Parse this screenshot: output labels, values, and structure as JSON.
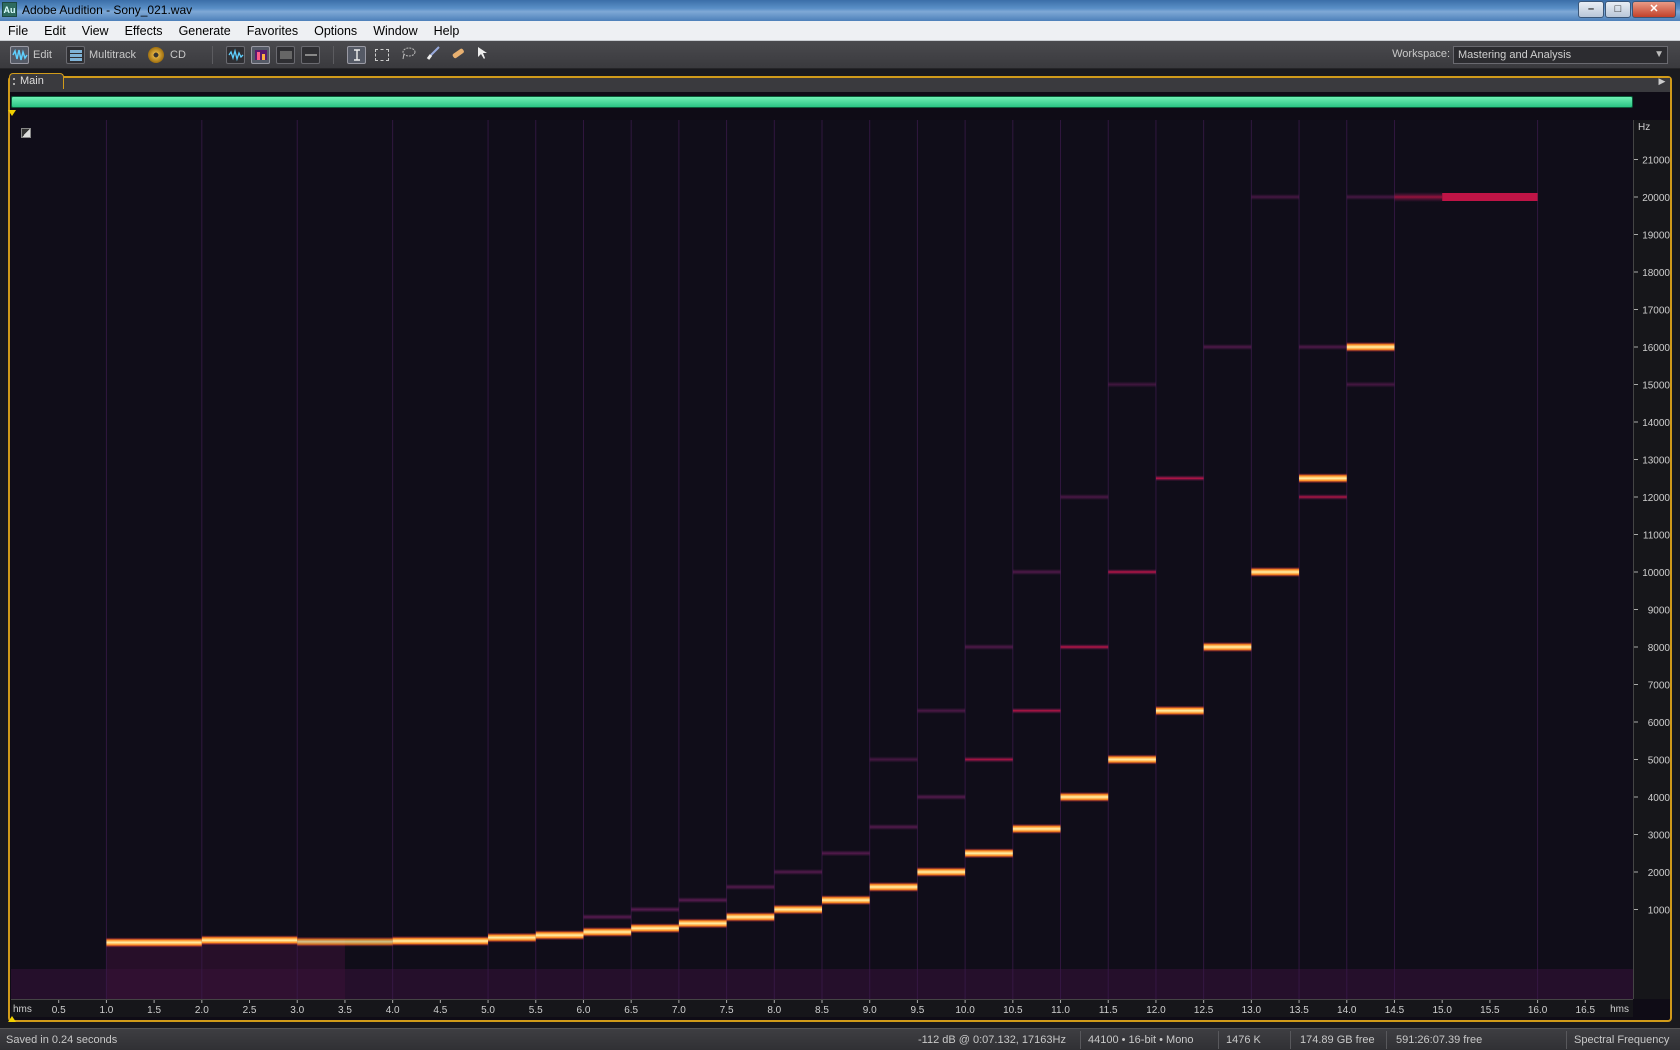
{
  "window": {
    "app_icon": "Au",
    "title": "Adobe Audition - Sony_021.wav",
    "controls": [
      "minimize",
      "maximize",
      "close"
    ]
  },
  "menu": [
    "File",
    "Edit",
    "View",
    "Effects",
    "Generate",
    "Favorites",
    "Options",
    "Window",
    "Help"
  ],
  "toolbar": {
    "views": [
      {
        "label": "Edit",
        "icon": "waveform-edit-icon",
        "active": true
      },
      {
        "label": "Multitrack",
        "icon": "multitrack-icon",
        "active": false
      },
      {
        "label": "CD",
        "icon": "cd-icon",
        "active": false
      }
    ],
    "display_modes": [
      "waveform-display-icon",
      "spectral-display-icon",
      "pan-display-icon",
      "phase-display-icon"
    ],
    "tools": [
      "time-selection-icon",
      "marquee-icon",
      "lasso-icon",
      "brush-icon",
      "spot-healing-icon",
      "move-icon"
    ],
    "workspace_label": "Workspace:",
    "workspace_value": "Mastering and Analysis"
  },
  "panel": {
    "tab_label": "Main"
  },
  "rulers": {
    "freq_unit": "Hz",
    "freq_ticks": [
      "21000",
      "20000",
      "19000",
      "18000",
      "17000",
      "16000",
      "15000",
      "14000",
      "13000",
      "12000",
      "11000",
      "10000",
      "9000",
      "8000",
      "7000",
      "6000",
      "5000",
      "4000",
      "3000",
      "2000",
      "1000"
    ],
    "time_unit": "hms",
    "time_ticks": [
      "0.5",
      "1.0",
      "1.5",
      "2.0",
      "2.5",
      "3.0",
      "3.5",
      "4.0",
      "4.5",
      "5.0",
      "5.5",
      "6.0",
      "6.5",
      "7.0",
      "7.5",
      "8.0",
      "8.5",
      "9.0",
      "9.5",
      "10.0",
      "10.5",
      "11.0",
      "11.5",
      "12.0",
      "12.5",
      "13.0",
      "13.5",
      "14.0",
      "14.5",
      "15.0",
      "15.5",
      "16.0",
      "16.5"
    ]
  },
  "spectrogram": {
    "freq_max_hz": 22050,
    "time_max_s": 17.0,
    "colors": {
      "background": "#100d19",
      "hot": "#fff2a8",
      "warm": "#ff8a1e",
      "mid": "#d3154b",
      "dim": "#6a1e5e"
    },
    "tones": [
      {
        "start": 1.0,
        "end": 2.0,
        "f": 120,
        "level": 1.0
      },
      {
        "start": 2.0,
        "end": 3.0,
        "f": 180,
        "level": 1.0
      },
      {
        "start": 3.0,
        "end": 4.0,
        "f": 140,
        "level": 0.8
      },
      {
        "start": 4.0,
        "end": 5.0,
        "f": 160,
        "level": 1.0
      },
      {
        "start": 5.0,
        "end": 5.5,
        "f": 250,
        "level": 1.0
      },
      {
        "start": 5.5,
        "end": 6.0,
        "f": 315,
        "level": 1.0
      },
      {
        "start": 6.0,
        "end": 6.5,
        "f": 400,
        "level": 1.0
      },
      {
        "start": 6.5,
        "end": 7.0,
        "f": 500,
        "level": 1.0
      },
      {
        "start": 7.0,
        "end": 7.5,
        "f": 630,
        "level": 1.0
      },
      {
        "start": 7.5,
        "end": 8.0,
        "f": 800,
        "level": 1.0
      },
      {
        "start": 8.0,
        "end": 8.5,
        "f": 1000,
        "level": 1.0
      },
      {
        "start": 8.5,
        "end": 9.0,
        "f": 1250,
        "level": 1.0
      },
      {
        "start": 9.0,
        "end": 9.5,
        "f": 1600,
        "level": 1.0
      },
      {
        "start": 9.5,
        "end": 10.0,
        "f": 2000,
        "level": 1.0
      },
      {
        "start": 10.0,
        "end": 10.5,
        "f": 2500,
        "level": 1.0
      },
      {
        "start": 10.5,
        "end": 11.0,
        "f": 3150,
        "level": 1.0
      },
      {
        "start": 11.0,
        "end": 11.5,
        "f": 4000,
        "level": 1.0
      },
      {
        "start": 11.5,
        "end": 12.0,
        "f": 5000,
        "level": 1.0
      },
      {
        "start": 12.0,
        "end": 12.5,
        "f": 6300,
        "level": 1.0
      },
      {
        "start": 12.5,
        "end": 13.0,
        "f": 8000,
        "level": 1.0
      },
      {
        "start": 13.0,
        "end": 13.5,
        "f": 10000,
        "level": 1.0
      },
      {
        "start": 13.5,
        "end": 14.0,
        "f": 12500,
        "level": 1.0
      },
      {
        "start": 14.0,
        "end": 14.5,
        "f": 16000,
        "level": 1.0
      },
      {
        "start": 14.5,
        "end": 15.0,
        "f": 20000,
        "level": 0.7
      }
    ],
    "harmonics": [
      {
        "start": 6.0,
        "end": 6.5,
        "f": 800,
        "level": 0.5
      },
      {
        "start": 6.5,
        "end": 7.0,
        "f": 1000,
        "level": 0.5
      },
      {
        "start": 7.0,
        "end": 7.5,
        "f": 1250,
        "level": 0.5
      },
      {
        "start": 7.5,
        "end": 8.0,
        "f": 1600,
        "level": 0.45
      },
      {
        "start": 8.0,
        "end": 8.5,
        "f": 2000,
        "level": 0.45
      },
      {
        "start": 8.5,
        "end": 9.0,
        "f": 2500,
        "level": 0.45
      },
      {
        "start": 9.0,
        "end": 9.5,
        "f": 3200,
        "level": 0.45
      },
      {
        "start": 9.0,
        "end": 9.5,
        "f": 5000,
        "level": 0.3
      },
      {
        "start": 9.5,
        "end": 10.0,
        "f": 4000,
        "level": 0.45
      },
      {
        "start": 9.5,
        "end": 10.0,
        "f": 6300,
        "level": 0.35
      },
      {
        "start": 10.0,
        "end": 10.5,
        "f": 5000,
        "level": 0.55
      },
      {
        "start": 10.0,
        "end": 10.5,
        "f": 8000,
        "level": 0.4
      },
      {
        "start": 10.5,
        "end": 11.0,
        "f": 6300,
        "level": 0.55
      },
      {
        "start": 10.5,
        "end": 11.0,
        "f": 10000,
        "level": 0.4
      },
      {
        "start": 11.0,
        "end": 11.5,
        "f": 8000,
        "level": 0.6
      },
      {
        "start": 11.0,
        "end": 11.5,
        "f": 12000,
        "level": 0.35
      },
      {
        "start": 11.5,
        "end": 12.0,
        "f": 10000,
        "level": 0.6
      },
      {
        "start": 11.5,
        "end": 12.0,
        "f": 15000,
        "level": 0.25
      },
      {
        "start": 12.0,
        "end": 12.5,
        "f": 12500,
        "level": 0.6
      },
      {
        "start": 12.0,
        "end": 12.5,
        "f": 6300,
        "level": 0.35
      },
      {
        "start": 12.5,
        "end": 13.0,
        "f": 16000,
        "level": 0.4
      },
      {
        "start": 12.5,
        "end": 13.0,
        "f": 8000,
        "level": 0.35
      },
      {
        "start": 13.0,
        "end": 13.5,
        "f": 20000,
        "level": 0.3
      },
      {
        "start": 13.0,
        "end": 13.5,
        "f": 10000,
        "level": 0.35
      },
      {
        "start": 13.5,
        "end": 14.0,
        "f": 12000,
        "level": 0.55
      },
      {
        "start": 13.5,
        "end": 14.0,
        "f": 16000,
        "level": 0.4
      },
      {
        "start": 14.0,
        "end": 14.5,
        "f": 20000,
        "level": 0.3
      },
      {
        "start": 14.0,
        "end": 14.5,
        "f": 15000,
        "level": 0.3
      }
    ]
  },
  "status": {
    "message": "Saved in 0.24 seconds",
    "cursor_readout": "-112 dB @   0:07.132, 17163Hz",
    "format": "44100 • 16-bit • Mono",
    "file_size": "1476 K",
    "disk_free": "174.89 GB free",
    "time_free": "591:26:07.39 free",
    "view_mode": "Spectral Frequency"
  }
}
